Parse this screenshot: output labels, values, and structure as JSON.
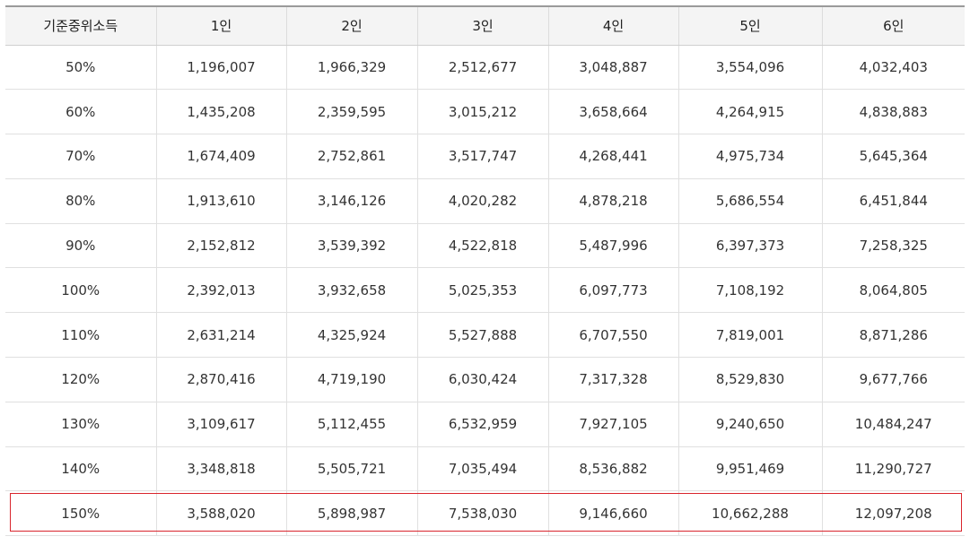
{
  "table": {
    "headers": [
      "기준중위소득",
      "1인",
      "2인",
      "3인",
      "4인",
      "5인",
      "6인"
    ],
    "rows": [
      [
        "50%",
        "1,196,007",
        "1,966,329",
        "2,512,677",
        "3,048,887",
        "3,554,096",
        "4,032,403"
      ],
      [
        "60%",
        "1,435,208",
        "2,359,595",
        "3,015,212",
        "3,658,664",
        "4,264,915",
        "4,838,883"
      ],
      [
        "70%",
        "1,674,409",
        "2,752,861",
        "3,517,747",
        "4,268,441",
        "4,975,734",
        "5,645,364"
      ],
      [
        "80%",
        "1,913,610",
        "3,146,126",
        "4,020,282",
        "4,878,218",
        "5,686,554",
        "6,451,844"
      ],
      [
        "90%",
        "2,152,812",
        "3,539,392",
        "4,522,818",
        "5,487,996",
        "6,397,373",
        "7,258,325"
      ],
      [
        "100%",
        "2,392,013",
        "3,932,658",
        "5,025,353",
        "6,097,773",
        "7,108,192",
        "8,064,805"
      ],
      [
        "110%",
        "2,631,214",
        "4,325,924",
        "5,527,888",
        "6,707,550",
        "7,819,001",
        "8,871,286"
      ],
      [
        "120%",
        "2,870,416",
        "4,719,190",
        "6,030,424",
        "7,317,328",
        "8,529,830",
        "9,677,766"
      ],
      [
        "130%",
        "3,109,617",
        "5,112,455",
        "6,532,959",
        "7,927,105",
        "9,240,650",
        "10,484,247"
      ],
      [
        "140%",
        "3,348,818",
        "5,505,721",
        "7,035,494",
        "8,536,882",
        "9,951,469",
        "11,290,727"
      ],
      [
        "150%",
        "3,588,020",
        "5,898,987",
        "7,538,030",
        "9,146,660",
        "10,662,288",
        "12,097,208"
      ]
    ],
    "highlighted_row": "150%",
    "highlight_color": "#d9262d"
  }
}
